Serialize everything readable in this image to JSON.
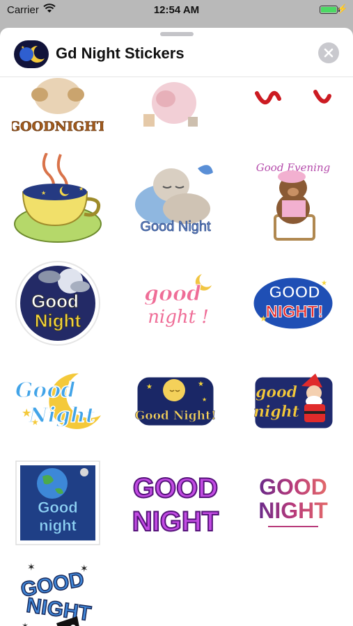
{
  "status": {
    "carrier": "Carrier",
    "time": "12:54 AM",
    "battery_level": 1.0
  },
  "header": {
    "app_name": "Gd Night Stickers",
    "close_icon": "close-icon"
  },
  "stickers": [
    {
      "label": "GOODNIGHT"
    },
    {
      "label": ""
    },
    {
      "label": ""
    },
    {
      "label": ""
    },
    {
      "label": "Good Night"
    },
    {
      "label": "Good Evening"
    },
    {
      "label_line1": "Good",
      "label_line2": "Night"
    },
    {
      "label_line1": "good",
      "label_line2": "night !"
    },
    {
      "label_line1": "GOOD",
      "label_line2": "NIGHT!"
    },
    {
      "label_line1": "Good",
      "label_line2": "Night"
    },
    {
      "label": "Good Night!"
    },
    {
      "label_line1": "good",
      "label_line2": "night"
    },
    {
      "label_line1": "Good",
      "label_line2": "night"
    },
    {
      "label_line1": "GOOD",
      "label_line2": "NIGHT"
    },
    {
      "label_line1": "GOOD",
      "label_line2": "NIGHT"
    },
    {
      "label_line1": "GOOD",
      "label_line2": "NIGHT"
    }
  ]
}
